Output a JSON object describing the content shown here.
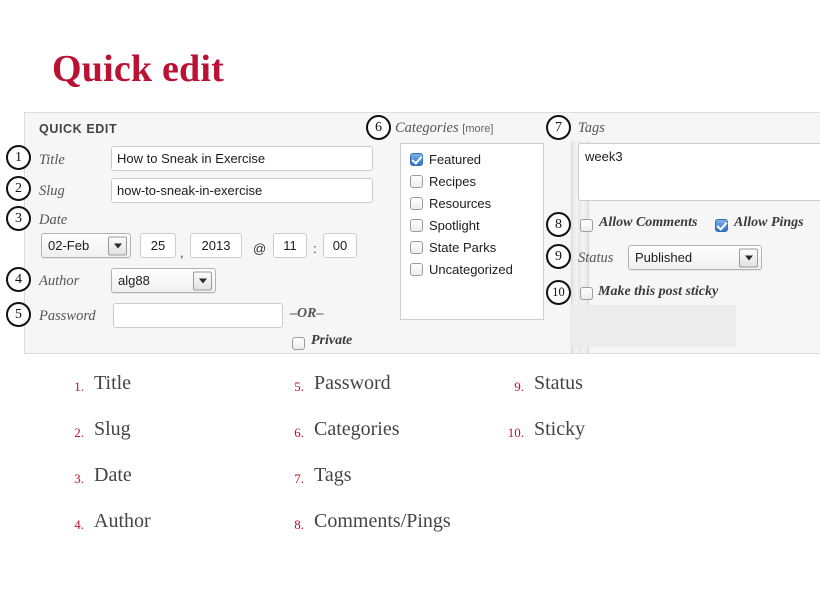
{
  "page": {
    "title": "Quick edit"
  },
  "panel": {
    "header": "QUICK EDIT",
    "fields": {
      "title": {
        "label": "Title",
        "value": "How to Sneak in Exercise"
      },
      "slug": {
        "label": "Slug",
        "value": "how-to-sneak-in-exercise"
      },
      "date": {
        "label": "Date",
        "month": "02-Feb",
        "day": "25",
        "comma": ",",
        "year": "2013",
        "at": "@",
        "hour": "11",
        "colon": ":",
        "minute": "00"
      },
      "author": {
        "label": "Author",
        "value": "alg88"
      },
      "password": {
        "label": "Password",
        "value": "",
        "or_text": "–OR–"
      },
      "private": {
        "label": "Private",
        "checked": false
      }
    },
    "categories": {
      "label": "Categories",
      "more_link": "[more]",
      "items": [
        {
          "label": "Featured",
          "checked": true
        },
        {
          "label": "Recipes",
          "checked": false
        },
        {
          "label": "Resources",
          "checked": false
        },
        {
          "label": "Spotlight",
          "checked": false
        },
        {
          "label": "State Parks",
          "checked": false
        },
        {
          "label": "Uncategorized",
          "checked": false
        }
      ]
    },
    "tags": {
      "label": "Tags",
      "value": "week3"
    },
    "allow_comments": {
      "label": "Allow Comments",
      "checked": false
    },
    "allow_pings": {
      "label": "Allow Pings",
      "checked": true
    },
    "status": {
      "label": "Status",
      "value": "Published"
    },
    "sticky": {
      "label": "Make this post sticky",
      "checked": false
    },
    "badges": {
      "b1": "1",
      "b2": "2",
      "b3": "3",
      "b4": "4",
      "b5": "5",
      "b6": "6",
      "b7": "7",
      "b8": "8",
      "b9": "9",
      "b10": "10"
    }
  },
  "legend": {
    "columns": [
      {
        "items": [
          {
            "num": "1.",
            "text": "Title"
          },
          {
            "num": "2.",
            "text": "Slug"
          },
          {
            "num": "3.",
            "text": "Date"
          },
          {
            "num": "4.",
            "text": "Author"
          }
        ]
      },
      {
        "items": [
          {
            "num": "5.",
            "text": "Password"
          },
          {
            "num": "6.",
            "text": "Categories"
          },
          {
            "num": "7.",
            "text": "Tags"
          },
          {
            "num": "8.",
            "text": "Comments/Pings"
          }
        ]
      },
      {
        "items": [
          {
            "num": "9.",
            "text": "Status"
          },
          {
            "num": "10.",
            "text": "Sticky"
          }
        ]
      }
    ]
  },
  "colors": {
    "accent": "#bb1133",
    "panel_bg": "#f6f6f6",
    "checkbox_on": "#2f74c6",
    "text": "#444444"
  }
}
